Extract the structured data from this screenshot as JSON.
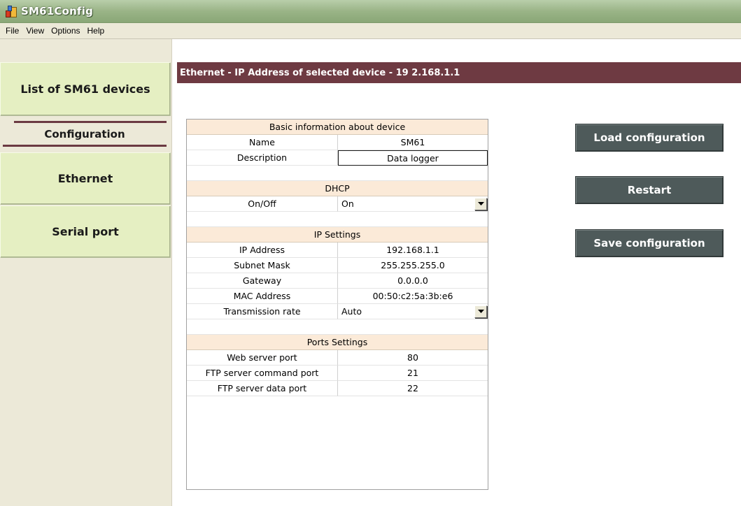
{
  "window": {
    "title": "SM61Config",
    "icon": "app-icon"
  },
  "menu": {
    "items": [
      "File",
      "View",
      "Options",
      "Help"
    ]
  },
  "sidebar": {
    "list_devices_label": "List of SM61 devices",
    "configuration_label": "Configuration",
    "ethernet_label": "Ethernet",
    "serial_label": "Serial port"
  },
  "main": {
    "header": "Ethernet - IP Address of selected device - 19 2.168.1.1"
  },
  "grid": {
    "basic": {
      "title": "Basic information about device",
      "name_label": "Name",
      "name_value": "SM61",
      "description_label": "Description",
      "description_value": "Data logger"
    },
    "dhcp": {
      "title": "DHCP",
      "onoff_label": "On/Off",
      "onoff_value": "On"
    },
    "ip": {
      "title": "IP Settings",
      "ip_label": "IP Address",
      "ip_value": "192.168.1.1",
      "mask_label": "Subnet Mask",
      "mask_value": "255.255.255.0",
      "gateway_label": "Gateway",
      "gateway_value": "0.0.0.0",
      "mac_label": "MAC Address",
      "mac_value": "00:50:c2:5a:3b:e6",
      "rate_label": "Transmission rate",
      "rate_value": "Auto"
    },
    "ports": {
      "title": "Ports Settings",
      "web_label": "Web server port",
      "web_value": "80",
      "ftp_cmd_label": "FTP server command port",
      "ftp_cmd_value": "21",
      "ftp_data_label": "FTP server data port",
      "ftp_data_value": "22"
    }
  },
  "actions": {
    "load_label": "Load configuration",
    "restart_label": "Restart",
    "save_label": "Save configuration"
  },
  "colors": {
    "title_bar": "#9ab487",
    "nav_button": "#e5efc2",
    "section_header": "#6e3a42",
    "group_row": "#fbead8",
    "action_button": "#4e5a5a"
  }
}
